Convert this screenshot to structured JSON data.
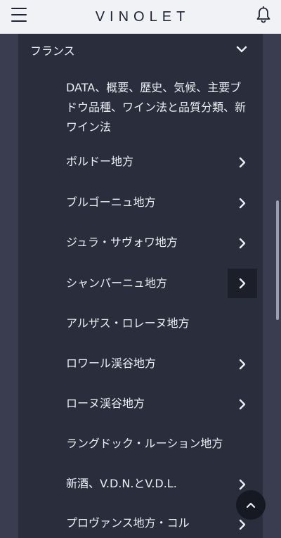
{
  "header": {
    "logo": "VINOLET"
  },
  "section": {
    "title": "フランス"
  },
  "items": [
    {
      "label": "DATA、概要、歴史、気候、主要ブドウ品種、ワイン法と品質分類、新ワイン法",
      "has_arrow": false
    },
    {
      "label": "ボルドー地方",
      "has_arrow": true
    },
    {
      "label": "ブルゴーニュ地方",
      "has_arrow": true
    },
    {
      "label": "ジュラ・サヴォワ地方",
      "has_arrow": true
    },
    {
      "label": "シャンパーニュ地方",
      "has_arrow": true,
      "active": true
    },
    {
      "label": "アルザス・ロレーヌ地方",
      "has_arrow": false
    },
    {
      "label": "ロワール渓谷地方",
      "has_arrow": true
    },
    {
      "label": "ローヌ渓谷地方",
      "has_arrow": true
    },
    {
      "label": "ラングドック・ルーション地方",
      "has_arrow": false
    },
    {
      "label": "新酒、V.D.N.とV.D.L.",
      "has_arrow": true
    },
    {
      "label": "プロヴァンス地方・コル",
      "has_arrow": true
    }
  ],
  "icons": {
    "menu": "hamburger-menu-icon",
    "notification": "bell-icon",
    "expand": "chevron-down-icon",
    "navigate": "chevron-right-icon",
    "scroll_top": "chevron-up-icon"
  },
  "colors": {
    "header_bg": "#f0f2f5",
    "panel_bg": "#2a2d3c",
    "page_bg": "#3a3d4f",
    "text": "#eceef4"
  }
}
